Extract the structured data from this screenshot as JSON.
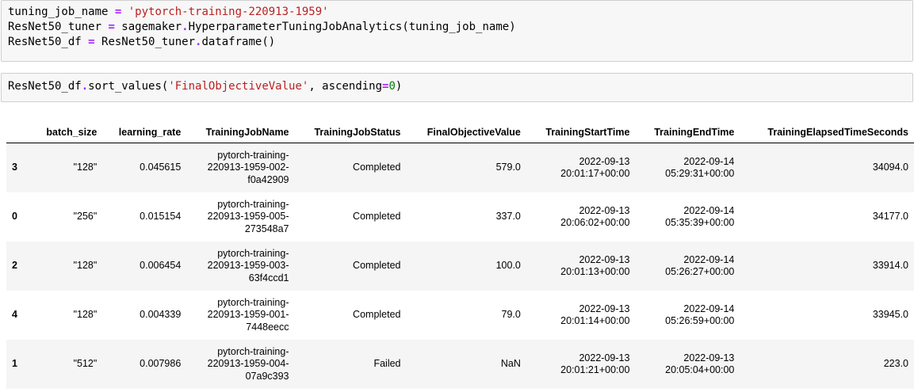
{
  "code_cells": [
    {
      "lines": [
        [
          {
            "t": "tuning_job_name ",
            "c": ""
          },
          {
            "t": "=",
            "c": "op"
          },
          {
            "t": " ",
            "c": ""
          },
          {
            "t": "'pytorch-training-220913-1959'",
            "c": "str"
          }
        ],
        [
          {
            "t": "ResNet50_tuner ",
            "c": ""
          },
          {
            "t": "=",
            "c": "op"
          },
          {
            "t": " sagemaker",
            "c": ""
          },
          {
            "t": ".",
            "c": "op"
          },
          {
            "t": "HyperparameterTuningJobAnalytics(tuning_job_name)",
            "c": ""
          }
        ],
        [
          {
            "t": "ResNet50_df ",
            "c": ""
          },
          {
            "t": "=",
            "c": "op"
          },
          {
            "t": " ResNet50_tuner",
            "c": ""
          },
          {
            "t": ".",
            "c": "op"
          },
          {
            "t": "dataframe()",
            "c": ""
          }
        ]
      ]
    },
    {
      "lines": [
        [
          {
            "t": "ResNet50_df",
            "c": ""
          },
          {
            "t": ".",
            "c": "op"
          },
          {
            "t": "sort_values(",
            "c": ""
          },
          {
            "t": "'FinalObjectiveValue'",
            "c": "str"
          },
          {
            "t": ", ascending",
            "c": ""
          },
          {
            "t": "=",
            "c": "op"
          },
          {
            "t": "0",
            "c": "num"
          },
          {
            "t": ")",
            "c": ""
          }
        ]
      ]
    }
  ],
  "dataframe": {
    "columns": [
      "",
      "batch_size",
      "learning_rate",
      "TrainingJobName",
      "TrainingJobStatus",
      "FinalObjectiveValue",
      "TrainingStartTime",
      "TrainingEndTime",
      "TrainingElapsedTimeSeconds"
    ],
    "rows": [
      {
        "index": "3",
        "batch_size": "\"128\"",
        "learning_rate": "0.045615",
        "job_name": [
          "pytorch-training-",
          "220913-1959-002-",
          "f0a42909"
        ],
        "status": "Completed",
        "objective": "579.0",
        "start": [
          "2022-09-13",
          "20:01:17+00:00"
        ],
        "end": [
          "2022-09-14",
          "05:29:31+00:00"
        ],
        "elapsed": "34094.0"
      },
      {
        "index": "0",
        "batch_size": "\"256\"",
        "learning_rate": "0.015154",
        "job_name": [
          "pytorch-training-",
          "220913-1959-005-",
          "273548a7"
        ],
        "status": "Completed",
        "objective": "337.0",
        "start": [
          "2022-09-13",
          "20:06:02+00:00"
        ],
        "end": [
          "2022-09-14",
          "05:35:39+00:00"
        ],
        "elapsed": "34177.0"
      },
      {
        "index": "2",
        "batch_size": "\"128\"",
        "learning_rate": "0.006454",
        "job_name": [
          "pytorch-training-",
          "220913-1959-003-",
          "63f4ccd1"
        ],
        "status": "Completed",
        "objective": "100.0",
        "start": [
          "2022-09-13",
          "20:01:13+00:00"
        ],
        "end": [
          "2022-09-14",
          "05:26:27+00:00"
        ],
        "elapsed": "33914.0"
      },
      {
        "index": "4",
        "batch_size": "\"128\"",
        "learning_rate": "0.004339",
        "job_name": [
          "pytorch-training-",
          "220913-1959-001-",
          "7448eecc"
        ],
        "status": "Completed",
        "objective": "79.0",
        "start": [
          "2022-09-13",
          "20:01:14+00:00"
        ],
        "end": [
          "2022-09-14",
          "05:26:59+00:00"
        ],
        "elapsed": "33945.0"
      },
      {
        "index": "1",
        "batch_size": "\"512\"",
        "learning_rate": "0.007986",
        "job_name": [
          "pytorch-training-",
          "220913-1959-004-",
          "07a9c393"
        ],
        "status": "Failed",
        "objective": "NaN",
        "start": [
          "2022-09-13",
          "20:01:21+00:00"
        ],
        "end": [
          "2022-09-13",
          "20:05:04+00:00"
        ],
        "elapsed": "223.0"
      }
    ]
  }
}
